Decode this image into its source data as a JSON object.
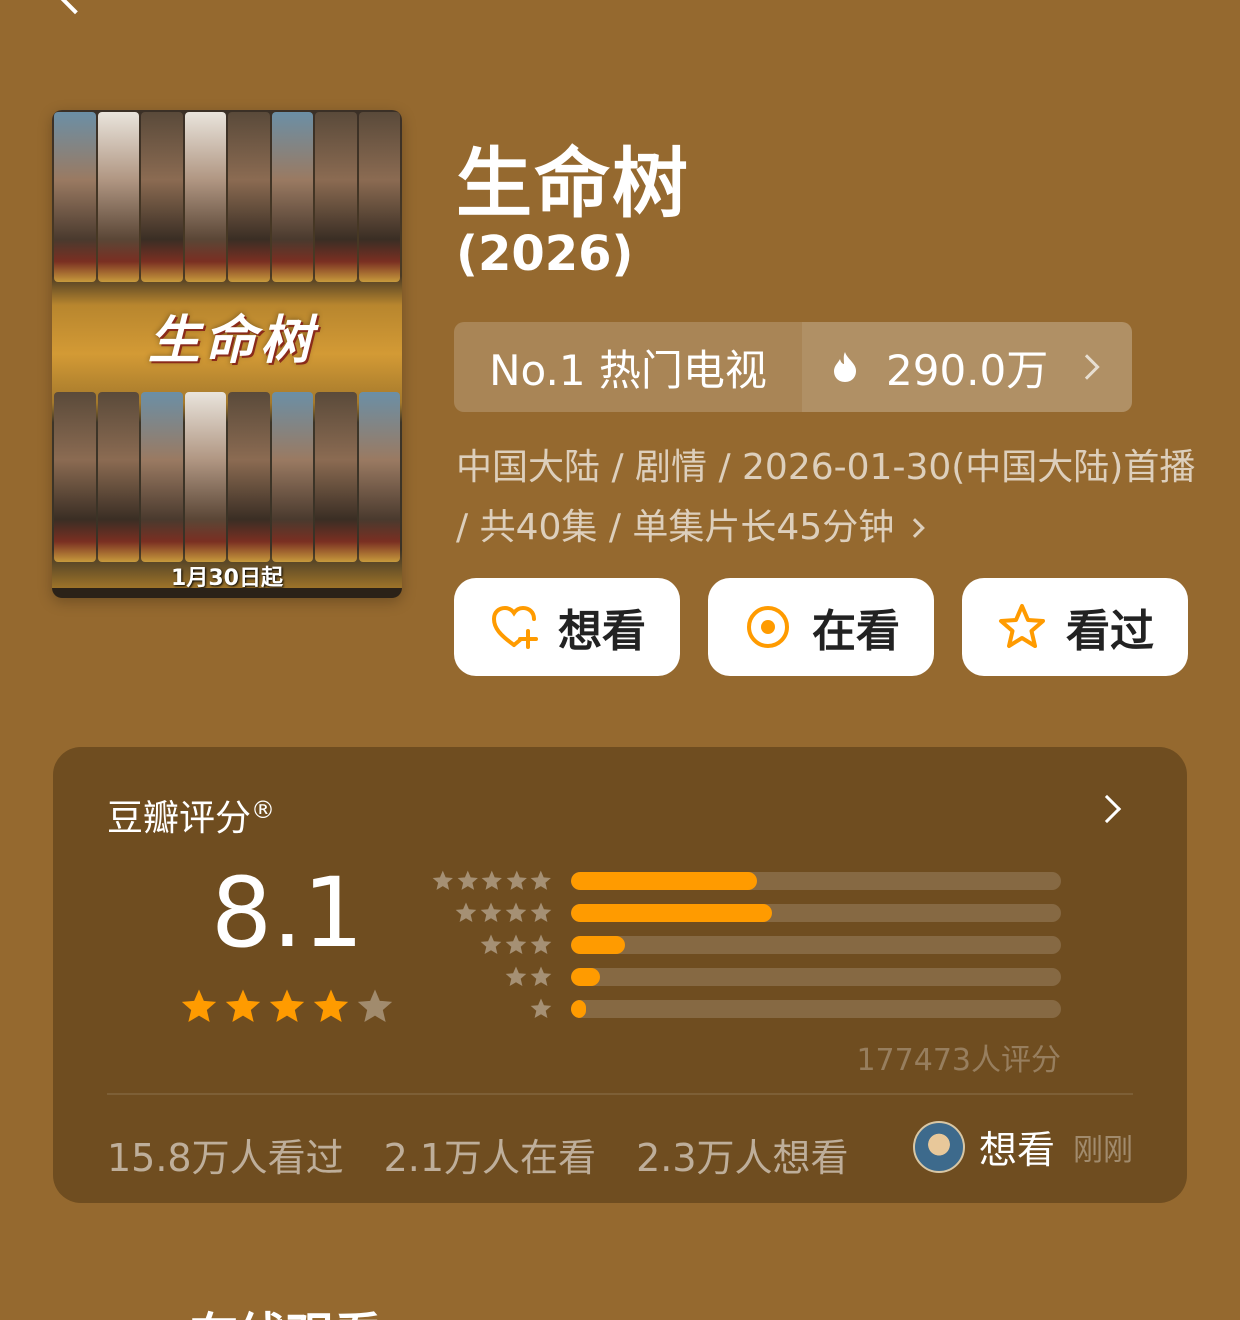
{
  "nav": {
    "back_icon": "chevron-left-icon"
  },
  "poster": {
    "title_art": "生命树",
    "date_text": "1月30日起"
  },
  "title": "生命树",
  "year": "(2026)",
  "rank": {
    "label": "No.1 热门电视",
    "heat_icon": "fire-icon",
    "heat_value": "290.0万"
  },
  "meta": {
    "text": "中国大陆 / 剧情 / 2026-01-30(中国大陆)首播 / 共40集 / 单集片长45分钟"
  },
  "actions": {
    "want": {
      "label": "想看",
      "icon": "heart-plus-icon"
    },
    "watching": {
      "label": "在看",
      "icon": "target-icon"
    },
    "watched": {
      "label": "看过",
      "icon": "star-outline-icon"
    },
    "accent_color": "#ff9b00"
  },
  "rating": {
    "title": "豆瓣评分",
    "registered_mark": "®",
    "score": "8.1",
    "stars_filled": 4,
    "stars_total": 5,
    "distribution": [
      {
        "stars": 5,
        "fraction": 0.38
      },
      {
        "stars": 4,
        "fraction": 0.41
      },
      {
        "stars": 3,
        "fraction": 0.11
      },
      {
        "stars": 2,
        "fraction": 0.06
      },
      {
        "stars": 1,
        "fraction": 0.03
      }
    ],
    "votes": "177473人评分",
    "bar_color": "#ff9b00"
  },
  "stats": {
    "watched": "15.8万人看过",
    "watching": "2.1万人在看",
    "want": "2.3万人想看"
  },
  "activity": {
    "label": "想看",
    "time": "刚刚"
  },
  "next_section": "在线观看"
}
